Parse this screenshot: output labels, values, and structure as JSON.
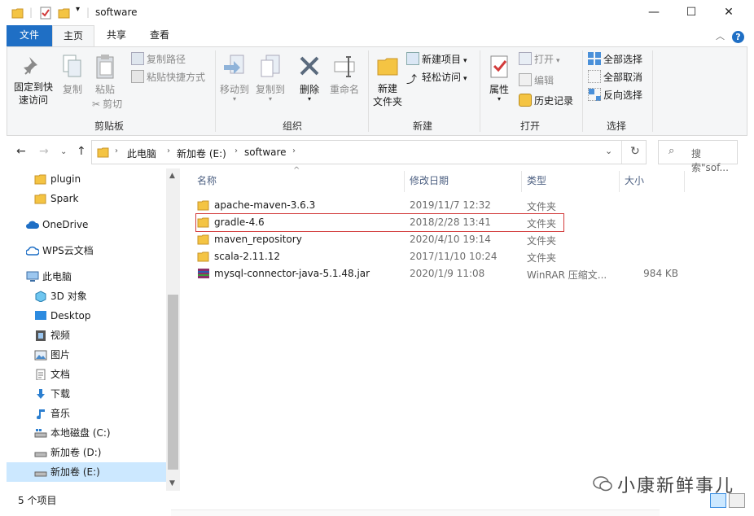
{
  "window": {
    "title": "software",
    "minimize_label": "—",
    "maximize_label": "☐",
    "close_label": "✕"
  },
  "tabs": {
    "file": "文件",
    "home": "主页",
    "share": "共享",
    "view": "查看"
  },
  "ribbon": {
    "clipboard": {
      "label": "剪贴板",
      "pin": "固定到快速访问",
      "pin_line1": "固定到快",
      "pin_line2": "速访问",
      "copy": "复制",
      "paste": "粘贴",
      "copy_path": "复制路径",
      "paste_shortcut": "粘贴快捷方式",
      "cut": "剪切"
    },
    "organize": {
      "label": "组织",
      "move_to": "移动到",
      "copy_to": "复制到",
      "delete": "删除",
      "rename": "重命名"
    },
    "new": {
      "label": "新建",
      "new_folder_line1": "新建",
      "new_folder_line2": "文件夹",
      "new_item": "新建项目",
      "easy_access": "轻松访问"
    },
    "open": {
      "label": "打开",
      "properties": "属性",
      "open": "打开",
      "edit": "编辑",
      "history": "历史记录"
    },
    "select": {
      "label": "选择",
      "select_all": "全部选择",
      "select_none": "全部取消",
      "invert": "反向选择"
    }
  },
  "address": {
    "crumbs": [
      "此电脑",
      "新加卷 (E:)",
      "software"
    ],
    "search_placeholder": "搜索\"sof..."
  },
  "nav": {
    "items": [
      {
        "label": "plugin",
        "icon": "folder-icon"
      },
      {
        "label": "Spark",
        "icon": "folder-icon"
      },
      {
        "label": "OneDrive",
        "icon": "cloud-icon"
      },
      {
        "label": "WPS云文档",
        "icon": "wps-cloud-icon"
      },
      {
        "label": "此电脑",
        "icon": "computer-icon"
      },
      {
        "label": "3D 对象",
        "icon": "3d-objects-icon"
      },
      {
        "label": "Desktop",
        "icon": "desktop-icon"
      },
      {
        "label": "视频",
        "icon": "video-icon"
      },
      {
        "label": "图片",
        "icon": "pictures-icon"
      },
      {
        "label": "文档",
        "icon": "documents-icon"
      },
      {
        "label": "下载",
        "icon": "download-icon"
      },
      {
        "label": "音乐",
        "icon": "music-icon"
      },
      {
        "label": "本地磁盘 (C:)",
        "icon": "drive-c-icon"
      },
      {
        "label": "新加卷 (D:)",
        "icon": "drive-icon"
      },
      {
        "label": "新加卷 (E:)",
        "icon": "drive-icon"
      }
    ]
  },
  "columns": {
    "name": "名称",
    "date": "修改日期",
    "type": "类型",
    "size": "大小"
  },
  "files": [
    {
      "name": "apache-maven-3.6.3",
      "date": "2019/11/7 12:32",
      "type": "文件夹",
      "size": "",
      "icon": "folder-icon"
    },
    {
      "name": "gradle-4.6",
      "date": "2018/2/28 13:41",
      "type": "文件夹",
      "size": "",
      "icon": "folder-icon"
    },
    {
      "name": "maven_repository",
      "date": "2020/4/10 19:14",
      "type": "文件夹",
      "size": "",
      "icon": "folder-icon"
    },
    {
      "name": "scala-2.11.12",
      "date": "2017/11/10 10:24",
      "type": "文件夹",
      "size": "",
      "icon": "folder-icon"
    },
    {
      "name": "mysql-connector-java-5.1.48.jar",
      "date": "2020/1/9 11:08",
      "type": "WinRAR 压缩文...",
      "size": "984 KB",
      "icon": "winrar-archive-icon"
    }
  ],
  "status": {
    "count": "5 个项目"
  },
  "watermark": {
    "text": "小康新鲜事儿"
  },
  "colors": {
    "accent": "#1f6fc5",
    "selection": "#cce8ff",
    "folder": "#f4c443",
    "highlight_box": "#d23b3b"
  }
}
